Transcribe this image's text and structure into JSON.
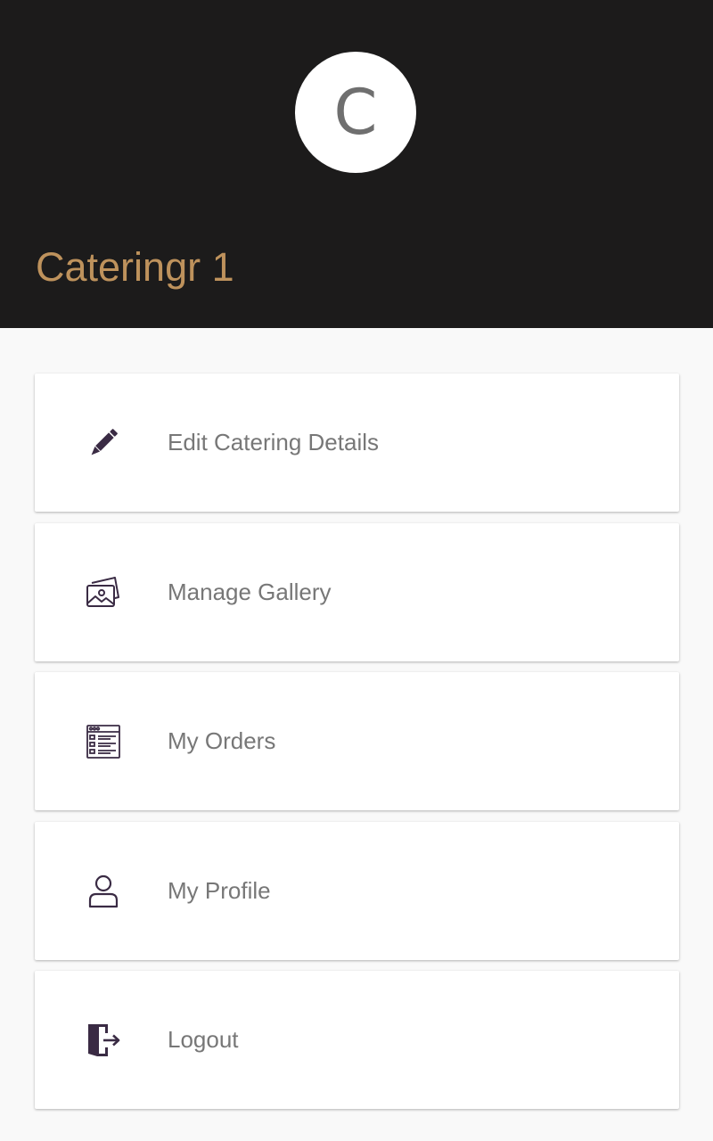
{
  "header": {
    "avatar_letter": "C",
    "username": "Cateringr 1",
    "background_color": "#1c1b1b",
    "username_color": "#be925c"
  },
  "menu": {
    "items": [
      {
        "label": "Edit Catering Details",
        "icon": "pencil-icon"
      },
      {
        "label": "Manage Gallery",
        "icon": "gallery-icon"
      },
      {
        "label": "My Orders",
        "icon": "orders-list-icon"
      },
      {
        "label": "My Profile",
        "icon": "user-icon"
      },
      {
        "label": "Logout",
        "icon": "logout-door-icon"
      }
    ],
    "icon_color": "#3a2b44",
    "label_color": "#777777"
  }
}
